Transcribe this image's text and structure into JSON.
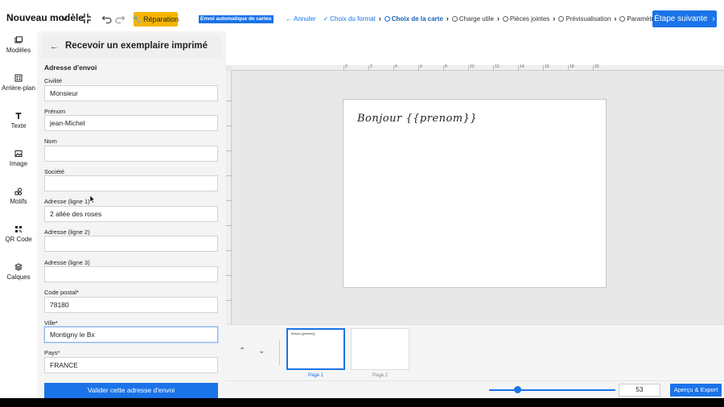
{
  "header": {
    "doc_title": "Nouveau modèle",
    "repair_label": "Réparation",
    "auto_badge": "Envoi automatique de cartes",
    "steps": [
      {
        "label": "Annuler",
        "state": "back"
      },
      {
        "label": "Choix du format",
        "state": "done"
      },
      {
        "label": "Choix de la carte",
        "state": "active"
      },
      {
        "label": "Charge utile",
        "state": "todo"
      },
      {
        "label": "Pièces jointes",
        "state": "todo"
      },
      {
        "label": "Prévisualisation",
        "state": "todo"
      },
      {
        "label": "Paramètres",
        "state": "todo"
      }
    ],
    "next_label": "Étape suivante"
  },
  "rail": {
    "items": [
      {
        "label": "Modèles",
        "icon": "templates-icon"
      },
      {
        "label": "Arrière-plan",
        "icon": "background-icon"
      },
      {
        "label": "Texte",
        "icon": "text-icon"
      },
      {
        "label": "Image",
        "icon": "image-icon"
      },
      {
        "label": "Motifs",
        "icon": "shapes-icon"
      },
      {
        "label": "QR Code",
        "icon": "qr-code-icon"
      },
      {
        "label": "Calques",
        "icon": "layers-icon"
      }
    ]
  },
  "panel": {
    "title": "Recevoir un exemplaire imprimé",
    "section": "Adresse d'envoi",
    "fields": [
      {
        "label": "Civilité",
        "value": "Monsieur"
      },
      {
        "label": "Prénom",
        "value": "jean-Michel"
      },
      {
        "label": "Nom",
        "value": ""
      },
      {
        "label": "Société",
        "value": ""
      },
      {
        "label": "Adresse (ligne 1)",
        "value": "2 allée des roses"
      },
      {
        "label": "Adresse (ligne 2)",
        "value": ""
      },
      {
        "label": "Adresse (ligne 3)",
        "value": ""
      },
      {
        "label": "Code postal*",
        "value": "78180"
      },
      {
        "label": "Ville*",
        "value": "Montigny le Bx"
      },
      {
        "label": "Pays*",
        "value": "FRANCE"
      }
    ],
    "validate_label": "Valider cette adresse d'envoi"
  },
  "canvas": {
    "text": "Bonjour {{prenom}}",
    "ruler_numbers": [
      "0",
      "2",
      "4",
      "6",
      "8",
      "10",
      "12",
      "14",
      "16",
      "18",
      "20"
    ]
  },
  "pages": [
    {
      "label": "Page 1",
      "text": "Bonjour {{prenom}}",
      "active": true
    },
    {
      "label": "Page 2",
      "text": "",
      "active": false
    }
  ],
  "zoom": {
    "value": "53",
    "level": 0.22
  },
  "export_label": "Aperçu & Export",
  "colors": {
    "accent": "#1a73e8",
    "repair": "#f5b400"
  }
}
